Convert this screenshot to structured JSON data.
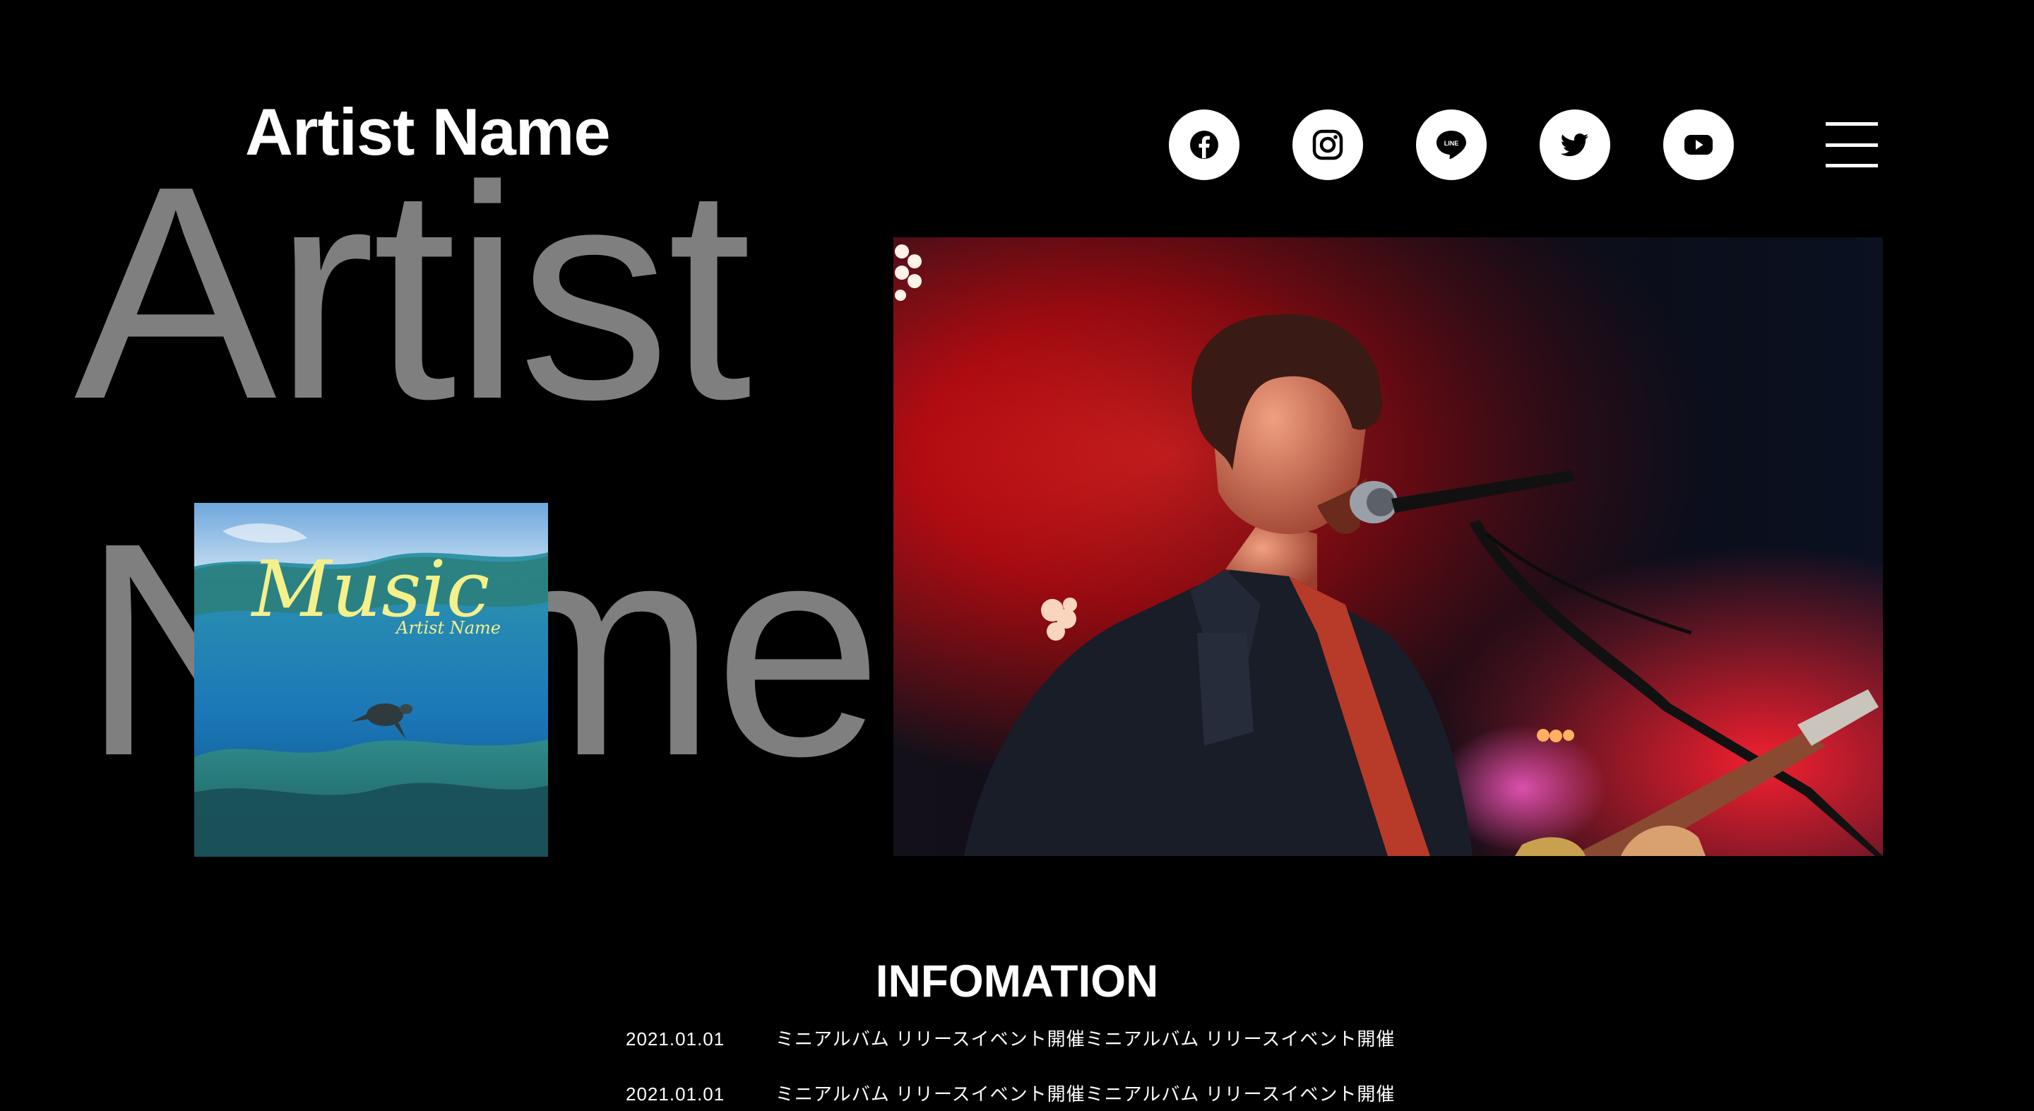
{
  "header": {
    "logo": "Artist Name",
    "social": [
      {
        "name": "facebook",
        "icon": "facebook-icon"
      },
      {
        "name": "instagram",
        "icon": "instagram-icon"
      },
      {
        "name": "line",
        "icon": "line-icon",
        "label": "LINE"
      },
      {
        "name": "twitter",
        "icon": "twitter-icon"
      },
      {
        "name": "youtube",
        "icon": "youtube-icon"
      }
    ],
    "menu_icon": "hamburger-menu-icon"
  },
  "hero": {
    "line1": "Artist",
    "line2": "Name"
  },
  "album": {
    "title": "Music",
    "artist": "Artist Name"
  },
  "information": {
    "heading": "INFOMATION",
    "items": [
      {
        "date": "2021.01.01",
        "title": "ミニアルバム リリースイベント開催ミニアルバム リリースイベント開催"
      },
      {
        "date": "2021.01.01",
        "title": "ミニアルバム リリースイベント開催ミニアルバム リリースイベント開催"
      }
    ]
  },
  "colors": {
    "background": "#000000",
    "text": "#ffffff",
    "hero_text": "#7f7f7f",
    "album_title": "#f4f08a"
  }
}
